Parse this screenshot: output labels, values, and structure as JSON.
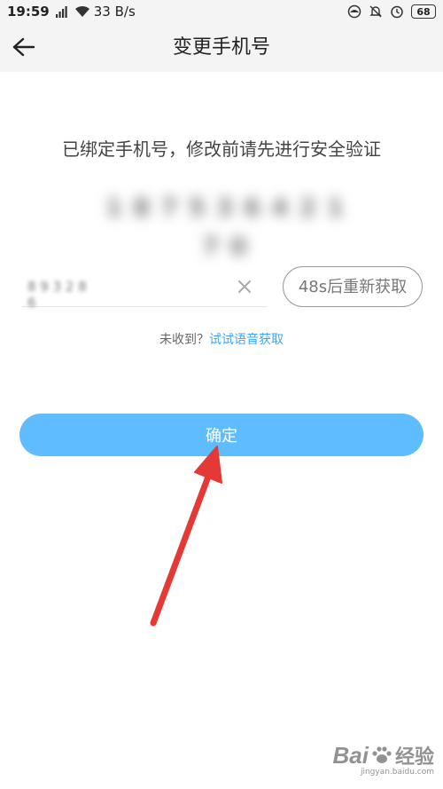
{
  "status_bar": {
    "time": "19:59",
    "network_speed": "33 B/s",
    "battery_level": "68"
  },
  "header": {
    "title": "变更手机号"
  },
  "verification": {
    "instruction": "已绑定手机号，修改前请先进行安全验证",
    "phone_number_masked": "1 8 7 5 3 6 4 2 1 7 0",
    "code_value": "8 9 3 2 8 6",
    "resend_label": "48s后重新获取",
    "voice_prompt": "未收到？",
    "voice_link": "试试语音获取"
  },
  "actions": {
    "confirm_label": "确定"
  },
  "watermark": {
    "brand": "Bai",
    "brand_suffix": "经验",
    "site": "jingyan.baidu.com"
  },
  "colors": {
    "accent": "#5fbdff",
    "link": "#3aa7ff",
    "annotation_arrow": "#e53935"
  }
}
